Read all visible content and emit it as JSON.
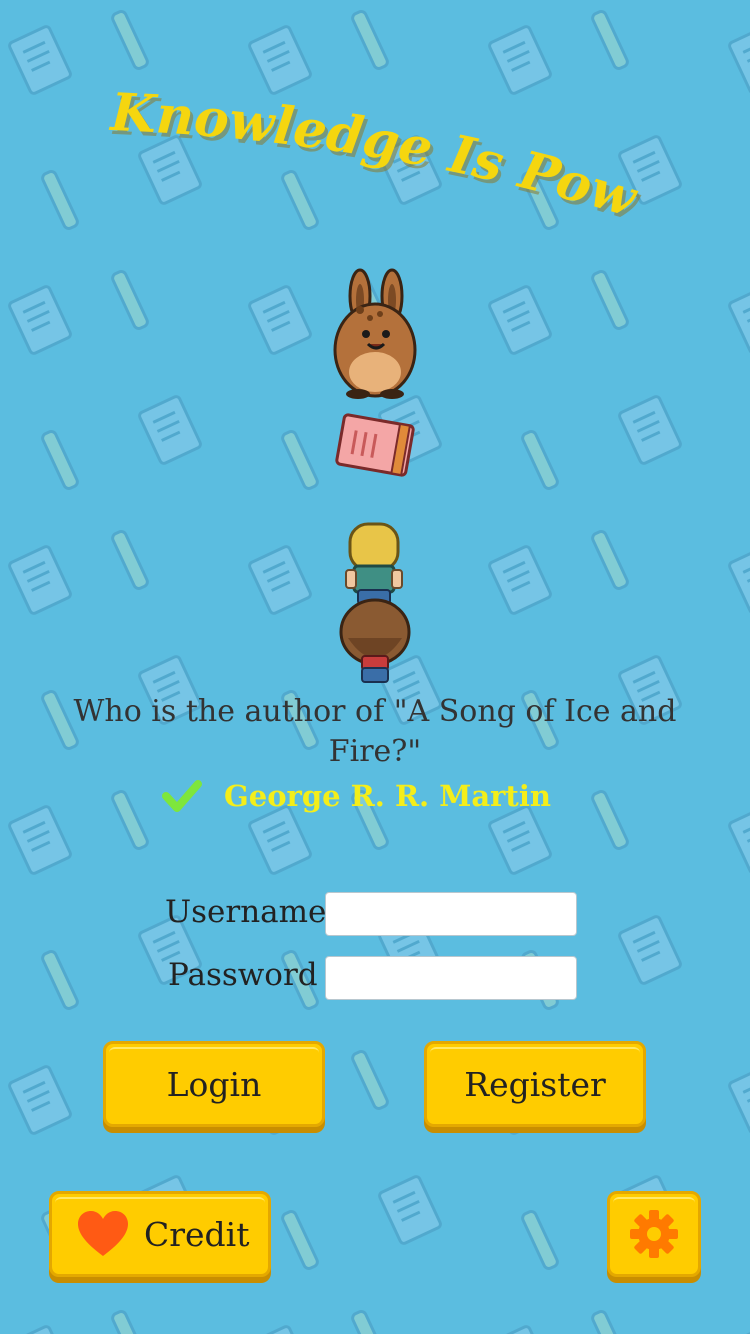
{
  "title": "Knowledge Is Power",
  "question": "Who is the author of \"A Song of Ice and Fire?\"",
  "answer": "George R. R. Martin",
  "form": {
    "username_label": "Username",
    "password_label": "Password",
    "username_value": "",
    "password_value": ""
  },
  "buttons": {
    "login": "Login",
    "register": "Register",
    "credit": "Credit"
  },
  "icons": {
    "answer": "check-icon",
    "credit": "heart-icon",
    "settings": "gear-icon"
  },
  "colors": {
    "background": "#5bbde0",
    "title": "#f5d60f",
    "answer": "#f4ee1a",
    "check": "#7ee63c",
    "button": "#ffcc00",
    "heart": "#ff5a14",
    "gear": "#ff7a00"
  }
}
